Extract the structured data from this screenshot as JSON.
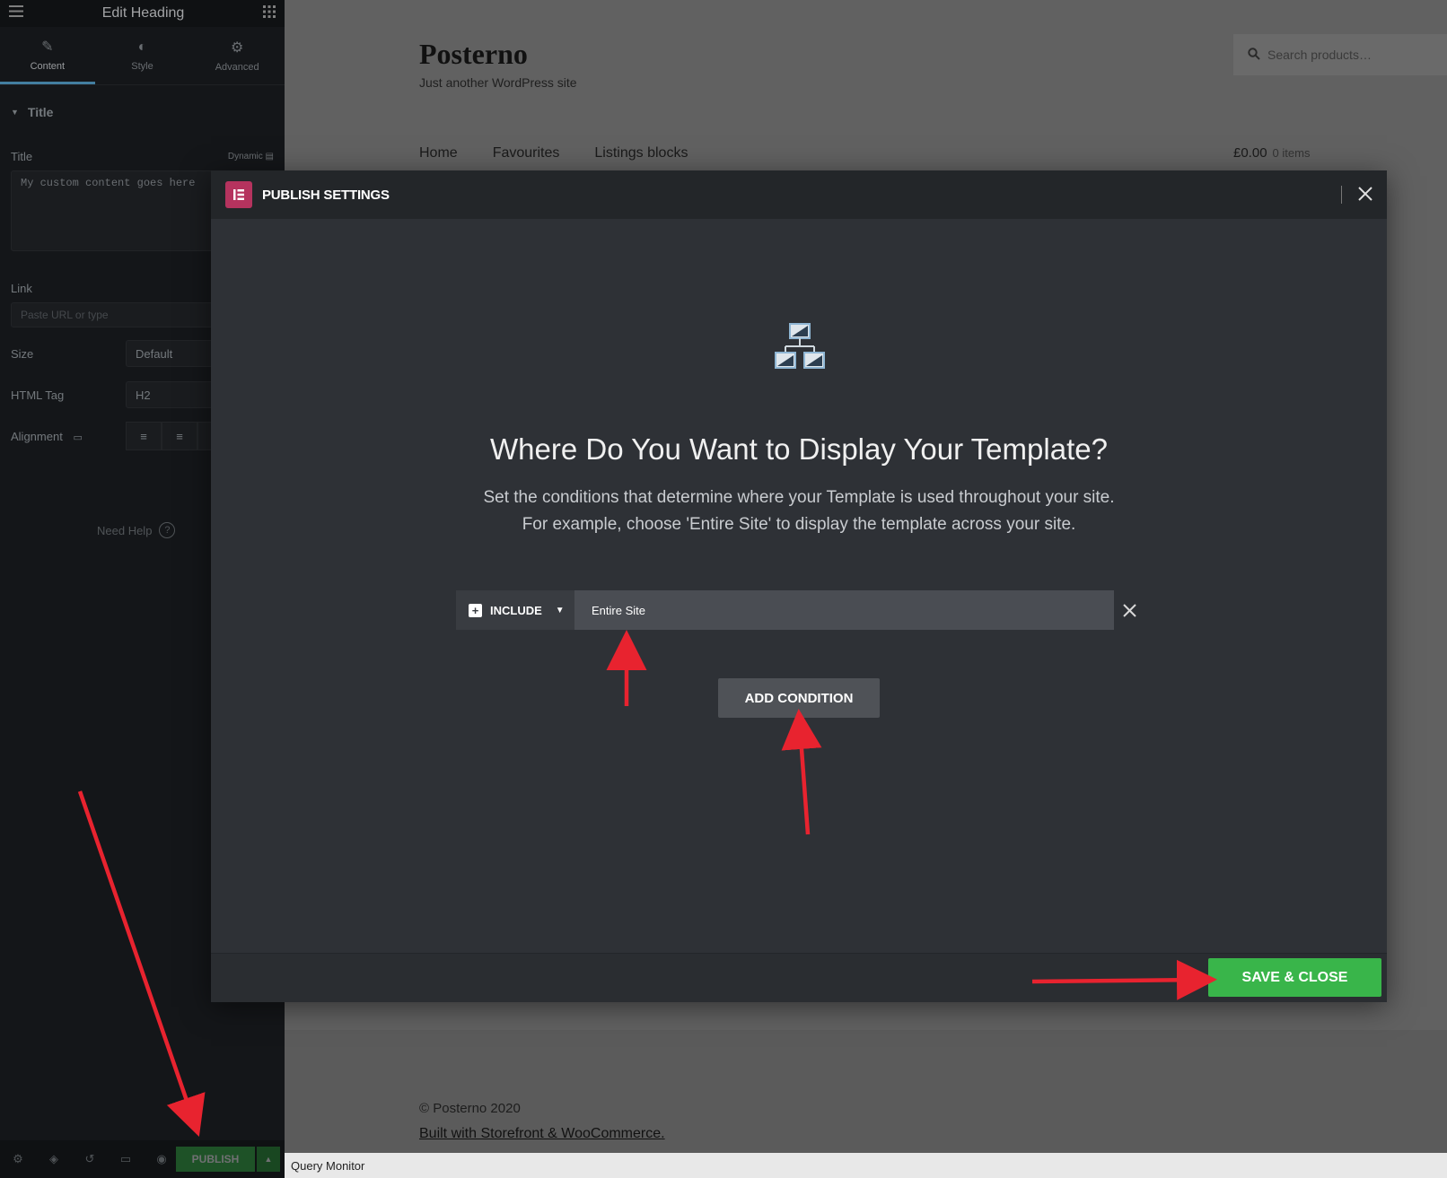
{
  "panel": {
    "title": "Edit Heading",
    "tabs": [
      {
        "label": "Content",
        "icon": "pencil-icon"
      },
      {
        "label": "Style",
        "icon": "contrast-icon"
      },
      {
        "label": "Advanced",
        "icon": "gear-icon"
      }
    ],
    "section_title": "Title",
    "title_label": "Title",
    "dynamic_label": "Dynamic",
    "title_value": "My custom content goes here",
    "link_label": "Link",
    "link_placeholder": "Paste URL or type",
    "size_label": "Size",
    "size_value": "Default",
    "html_tag_label": "HTML Tag",
    "html_tag_value": "H2",
    "alignment_label": "Alignment",
    "need_help": "Need Help",
    "publish_label": "PUBLISH"
  },
  "site": {
    "title": "Posterno",
    "tagline": "Just another WordPress site",
    "search_placeholder": "Search products…",
    "nav": [
      "Home",
      "Favourites",
      "Listings blocks"
    ],
    "cart_total": "£0.00",
    "cart_items": "0 items",
    "copyright": "© Posterno 2020",
    "built_with": "Built with Storefront & WooCommerce",
    "query_monitor": "Query Monitor"
  },
  "modal": {
    "title": "PUBLISH SETTINGS",
    "heading": "Where Do You Want to Display Your Template?",
    "description_line1": "Set the conditions that determine where your Template is used throughout your site.",
    "description_line2": "For example, choose 'Entire Site' to display the template across your site.",
    "condition_type": "INCLUDE",
    "condition_value": "Entire Site",
    "add_condition": "ADD CONDITION",
    "save_close": "SAVE & CLOSE"
  },
  "colors": {
    "accent_green": "#39b54a",
    "elementor_pink": "#b5335e",
    "annotation_red": "#e8232f"
  }
}
